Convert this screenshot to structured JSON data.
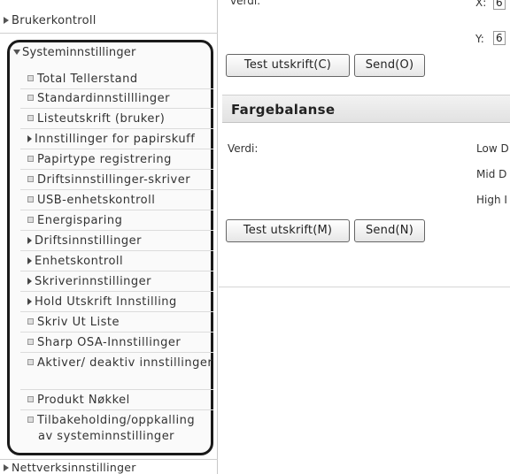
{
  "sidebar": {
    "top_item": "Brukerkontroll",
    "group": {
      "title": "Systeminnstillinger",
      "items": [
        {
          "label": "Total Tellerstand",
          "kind": "leaf"
        },
        {
          "label": "Standardinnstilllinger",
          "kind": "leaf"
        },
        {
          "label": "Listeutskrift (bruker)",
          "kind": "leaf"
        },
        {
          "label": "Innstillinger for papirskuff",
          "kind": "folder"
        },
        {
          "label": "Papirtype registrering",
          "kind": "leaf"
        },
        {
          "label": "Driftsinnstillinger-skriver",
          "kind": "leaf"
        },
        {
          "label": "USB-enhetskontroll",
          "kind": "leaf"
        },
        {
          "label": "Energisparing",
          "kind": "leaf"
        },
        {
          "label": "Driftsinnstillinger",
          "kind": "folder"
        },
        {
          "label": "Enhetskontroll",
          "kind": "folder"
        },
        {
          "label": "Skriverinnstillinger",
          "kind": "folder"
        },
        {
          "label": "Hold Utskrift Innstilling",
          "kind": "folder"
        },
        {
          "label": "Skriv Ut Liste",
          "kind": "leaf"
        },
        {
          "label": "Sharp OSA-Innstillinger",
          "kind": "leaf"
        },
        {
          "label": "Aktiver/ deaktiv innstillinger",
          "kind": "leaf"
        },
        {
          "label": "Produkt Nøkkel",
          "kind": "leaf"
        },
        {
          "label": "Tilbakeholding/oppkalling av systeminnstillinger",
          "kind": "leaf"
        }
      ]
    },
    "bottom_item": "Nettverksinnstillinger"
  },
  "main": {
    "top_value_label": "verdi:",
    "x_label": "X:",
    "x_value": "6",
    "y_label": "Y:",
    "y_value": "6",
    "buttons_top": {
      "test": "Test utskrift(C)",
      "send": "Send(O)"
    },
    "section_title": "Fargebalanse",
    "value_label": "Verdi:",
    "levels": [
      "Low D",
      "Mid D",
      "High I"
    ],
    "buttons_bottom": {
      "test": "Test utskrift(M)",
      "send": "Send(N)"
    }
  }
}
